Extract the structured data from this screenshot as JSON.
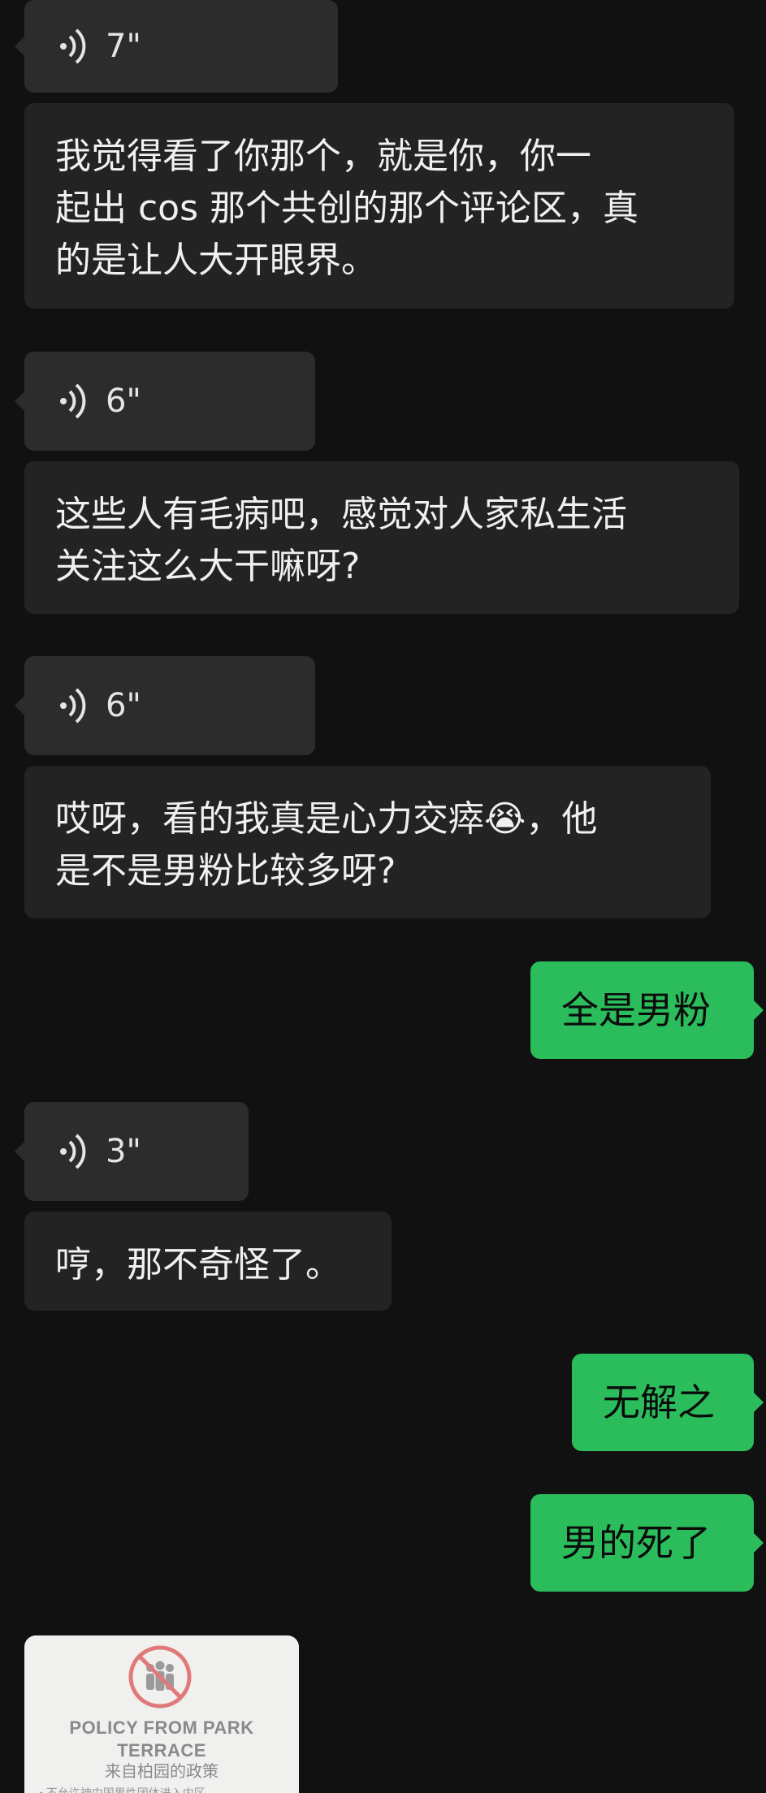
{
  "chat": {
    "messages": [
      {
        "type": "voice",
        "duration": "7\""
      },
      {
        "type": "text",
        "text": "我觉得看了你那个，就是你，你一\n起出 cos 那个共创的那个评论区，真\n的是让人大开眼界。"
      },
      {
        "type": "voice",
        "duration": "6\""
      },
      {
        "type": "text",
        "text": "这些人有毛病吧，感觉对人家私生活\n关注这么大干嘛呀?"
      },
      {
        "type": "voice",
        "duration": "6\""
      },
      {
        "type": "text",
        "text": "哎呀，看的我真是心力交瘁😭，他\n是不是男粉比较多呀?"
      },
      {
        "type": "text_out",
        "text": "全是男粉"
      },
      {
        "type": "voice",
        "duration": "3\""
      },
      {
        "type": "text",
        "text": "哼，那不奇怪了。"
      },
      {
        "type": "text_out",
        "text": "无解之"
      },
      {
        "type": "text_out",
        "text": "男的死了"
      }
    ],
    "sticker": {
      "title": "POLICY FROM PARK\nTERRACE",
      "subtitle": "来自柏园的政策",
      "note": "• 不允许神中国男性团体进入内区"
    }
  },
  "colors": {
    "background": "#111111",
    "incoming_voice": "#2c2c2c",
    "incoming_text": "#232323",
    "outgoing": "#2bbd5c"
  },
  "icons": {
    "voice": "voice-wave-icon",
    "sticker": "no-group-icon"
  }
}
